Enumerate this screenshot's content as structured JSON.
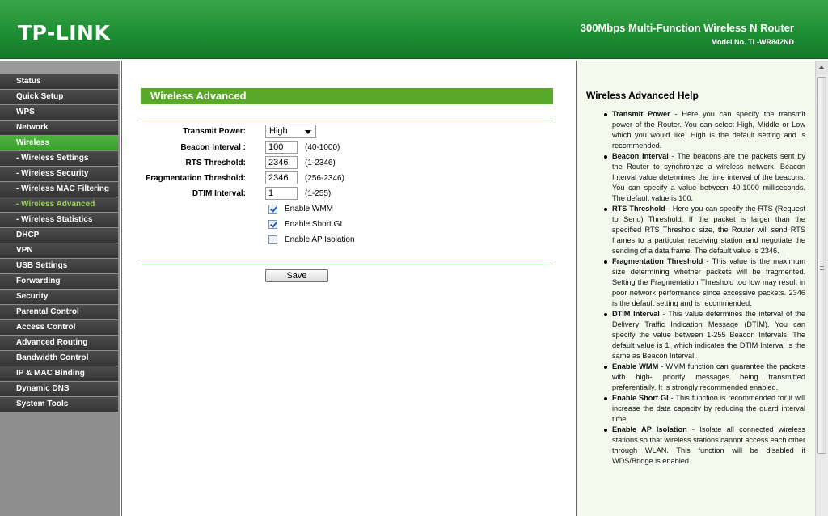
{
  "header": {
    "logo": "TP-LINK",
    "product_title": "300Mbps Multi-Function Wireless N Router",
    "model_no": "Model No. TL-WR842ND"
  },
  "sidebar": {
    "items": [
      {
        "label": "Status"
      },
      {
        "label": "Quick Setup"
      },
      {
        "label": "WPS"
      },
      {
        "label": "Network"
      },
      {
        "label": "Wireless"
      },
      {
        "label": "- Wireless Settings"
      },
      {
        "label": "- Wireless Security"
      },
      {
        "label": "- Wireless MAC Filtering"
      },
      {
        "label": "- Wireless Advanced"
      },
      {
        "label": "- Wireless Statistics"
      },
      {
        "label": "DHCP"
      },
      {
        "label": "VPN"
      },
      {
        "label": "USB Settings"
      },
      {
        "label": "Forwarding"
      },
      {
        "label": "Security"
      },
      {
        "label": "Parental Control"
      },
      {
        "label": "Access Control"
      },
      {
        "label": "Advanced Routing"
      },
      {
        "label": "Bandwidth Control"
      },
      {
        "label": "IP & MAC Binding"
      },
      {
        "label": "Dynamic DNS"
      },
      {
        "label": "System Tools"
      }
    ]
  },
  "main": {
    "section_title": "Wireless Advanced",
    "transmit_power": {
      "label": "Transmit Power:",
      "value": "High"
    },
    "beacon_interval": {
      "label": "Beacon Interval :",
      "value": "100",
      "range": "(40-1000)"
    },
    "rts_threshold": {
      "label": "RTS Threshold:",
      "value": "2346",
      "range": "(1-2346)"
    },
    "fragmentation_threshold": {
      "label": "Fragmentation Threshold:",
      "value": "2346",
      "range": "(256-2346)"
    },
    "dtim_interval": {
      "label": "DTIM Interval:",
      "value": "1",
      "range": "(1-255)"
    },
    "enable_wmm": {
      "label": "Enable WMM",
      "checked": true
    },
    "enable_short_gi": {
      "label": "Enable Short GI",
      "checked": true
    },
    "enable_ap_isolation": {
      "label": "Enable AP Isolation",
      "checked": false
    },
    "save_label": "Save"
  },
  "help": {
    "title": "Wireless Advanced Help",
    "items": [
      {
        "term": "Transmit Power",
        "text": " - Here you can specify the transmit power of the Router. You can select High, Middle or Low which you would like. High is the default setting and is recommended."
      },
      {
        "term": "Beacon Interval",
        "text": " - The beacons are the packets sent by the Router to synchronize a wireless network. Beacon Interval value determines the time interval of the beacons. You can specify a value between 40-1000 milliseconds. The default value is 100."
      },
      {
        "term": "RTS Threshold",
        "text": " - Here you can specify the RTS (Request to Send) Threshold. If the packet is larger than the specified RTS Threshold size, the Router will send RTS frames to a particular receiving station and negotiate the sending of a data frame. The default value is 2346."
      },
      {
        "term": "Fragmentation Threshold",
        "text": " - This value is the maximum size determining whether packets will be fragmented. Setting the Fragmentation Threshold too low may result in poor network performance since excessive packets. 2346 is the default setting and is recommended."
      },
      {
        "term": "DTIM Interval",
        "text": " - This value determines the interval of the Delivery Traffic Indication Message (DTIM). You can specify the value between 1-255 Beacon Intervals. The default value is 1, which indicates the DTIM Interval is the same as Beacon Interval."
      },
      {
        "term": "Enable WMM",
        "text": " - WMM function can guarantee the packets with high- priority messages being transmitted preferentially. It is strongly recommended enabled."
      },
      {
        "term": "Enable Short GI",
        "text": " - This function is recommended for it will increase the data capacity by reducing the guard interval time."
      },
      {
        "term": "Enable AP Isolation",
        "text": " - Isolate all connected wireless stations so that wireless stations cannot access each other through WLAN. This function will be disabled if WDS/Bridge is enabled."
      }
    ]
  },
  "colors": {
    "header_green": "#1d8d33",
    "section_green": "#58a82a",
    "menu_dark": "#3a3a3a",
    "menu_active": "#4fb33e",
    "submenu_active_text": "#9ad25a",
    "help_bg": "#f4f9ee"
  },
  "icons": {
    "checkbox_checked": "checkbox-checked-icon",
    "dropdown": "chevron-down-icon"
  }
}
